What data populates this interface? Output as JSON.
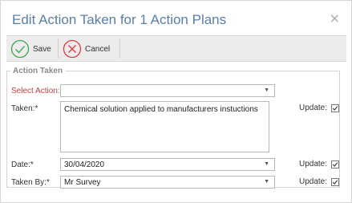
{
  "dialog": {
    "title": "Edit Action Taken for 1 Action Plans",
    "close_symbol": "×"
  },
  "toolbar": {
    "save_label": "Save",
    "save_icon": "check-circle-icon",
    "cancel_label": "Cancel",
    "cancel_icon": "x-circle-icon"
  },
  "group": {
    "legend": "Action Taken",
    "select_action": {
      "label": "Select Action:",
      "value": ""
    },
    "taken": {
      "label": "Taken:*",
      "value": "Chemical solution applied to manufacturers instuctions",
      "update_label": "Update:",
      "update_checked": true
    },
    "date": {
      "label": "Date:*",
      "value": "30/04/2020",
      "update_label": "Update:",
      "update_checked": true
    },
    "taken_by": {
      "label": "Taken By:*",
      "value": "Mr Survey",
      "update_label": "Update:",
      "update_checked": true
    }
  },
  "colors": {
    "title": "#5a7ea8",
    "required_label": "#d83b3b",
    "save_icon": "#3aa54a",
    "cancel_icon": "#e0393e"
  }
}
